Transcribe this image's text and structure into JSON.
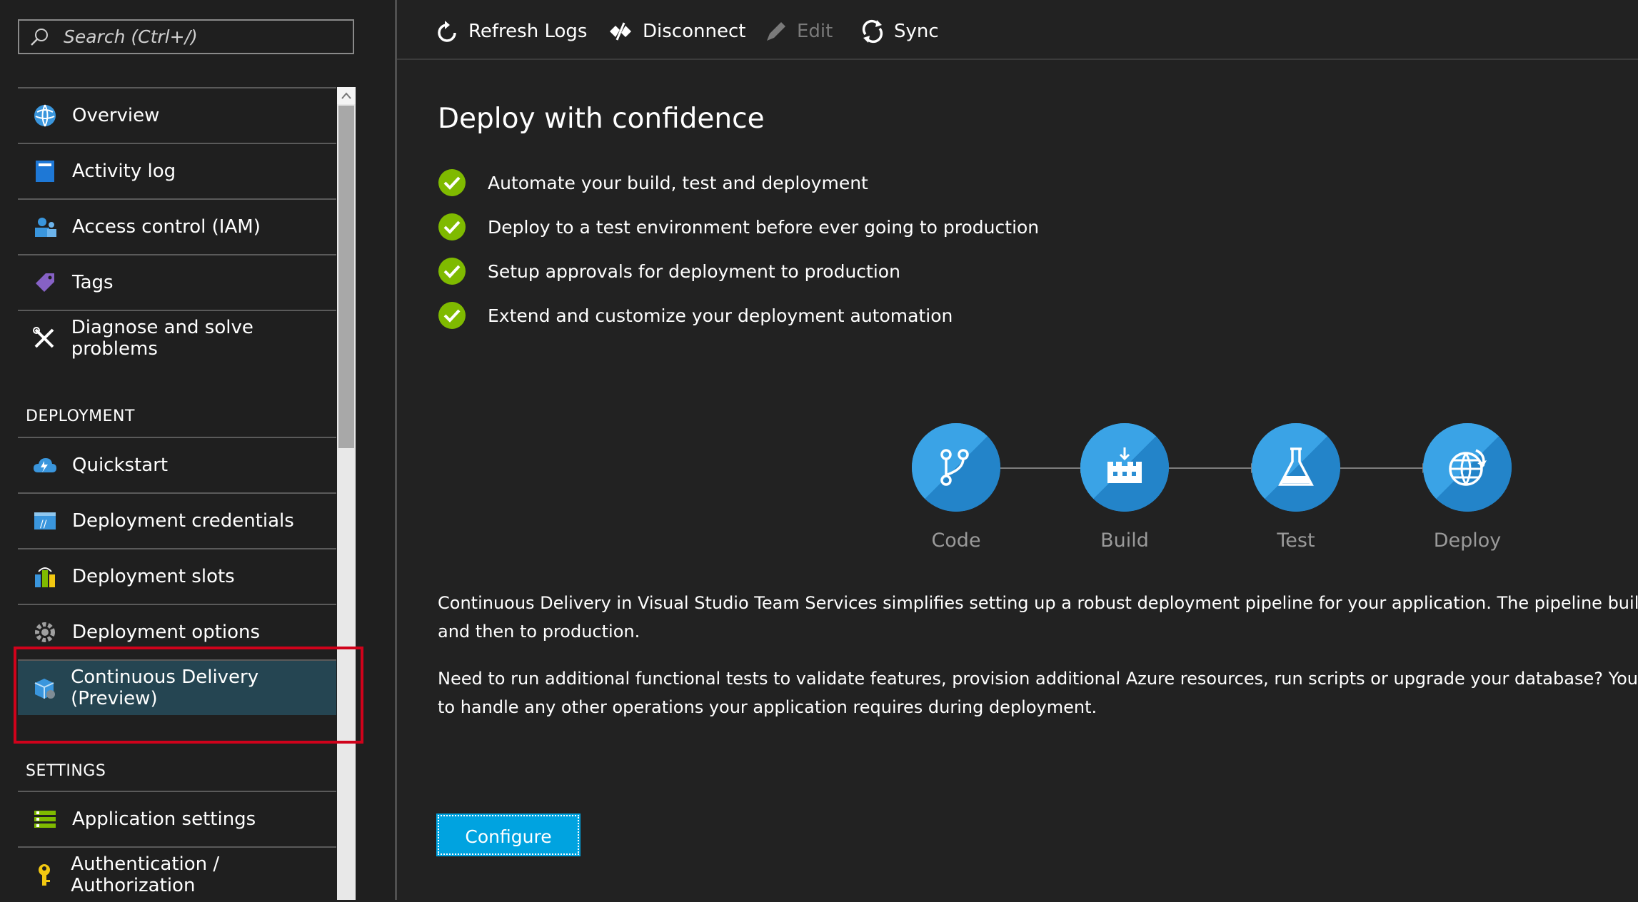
{
  "search": {
    "placeholder": "Search (Ctrl+/)"
  },
  "sidebar": {
    "items": [
      {
        "label": "Overview",
        "icon": "globe-icon"
      },
      {
        "label": "Activity log",
        "icon": "log-book-icon"
      },
      {
        "label": "Access control (IAM)",
        "icon": "users-icon"
      },
      {
        "label": "Tags",
        "icon": "tag-icon"
      },
      {
        "label": "Diagnose and solve problems",
        "icon": "tools-icon"
      }
    ],
    "deployment_section": "DEPLOYMENT",
    "deployment_items": [
      {
        "label": "Quickstart",
        "icon": "cloud-bolt-icon"
      },
      {
        "label": "Deployment credentials",
        "icon": "credentials-icon"
      },
      {
        "label": "Deployment slots",
        "icon": "slots-icon"
      },
      {
        "label": "Deployment options",
        "icon": "gear-icon"
      },
      {
        "label": "Continuous Delivery (Preview)",
        "icon": "delivery-box-icon",
        "selected": true
      }
    ],
    "settings_section": "SETTINGS",
    "settings_items": [
      {
        "label": "Application settings",
        "icon": "settings-list-icon"
      },
      {
        "label": "Authentication / Authorization",
        "icon": "key-icon"
      }
    ]
  },
  "toolbar": {
    "refresh_label": "Refresh Logs",
    "disconnect_label": "Disconnect",
    "edit_label": "Edit",
    "sync_label": "Sync"
  },
  "main": {
    "heading": "Deploy with confidence",
    "checks": [
      "Automate your build, test and deployment",
      "Deploy to a test environment before ever going to production",
      "Setup approvals for deployment to production",
      "Extend and customize your deployment automation"
    ],
    "pipeline": [
      "Code",
      "Build",
      "Test",
      "Deploy"
    ],
    "para1_line1": "Continuous Delivery in Visual Studio Team Services simplifies setting up a robust deployment pipeline for your application. The pipeline builds, ru",
    "para1_line2": "and then to production.",
    "para2_line1": "Need to run additional functional tests to validate features, provision additional Azure resources, run scripts or upgrade your database? You can e",
    "para2_line2": "to handle any other operations your application requires during deployment.",
    "configure_label": "Configure"
  },
  "colors": {
    "accent": "#00a3e0",
    "check_green": "#7fba00",
    "pipeline_blue": "#2a8ed3",
    "highlight_red": "#d0021b",
    "selected_bg": "#254552"
  }
}
